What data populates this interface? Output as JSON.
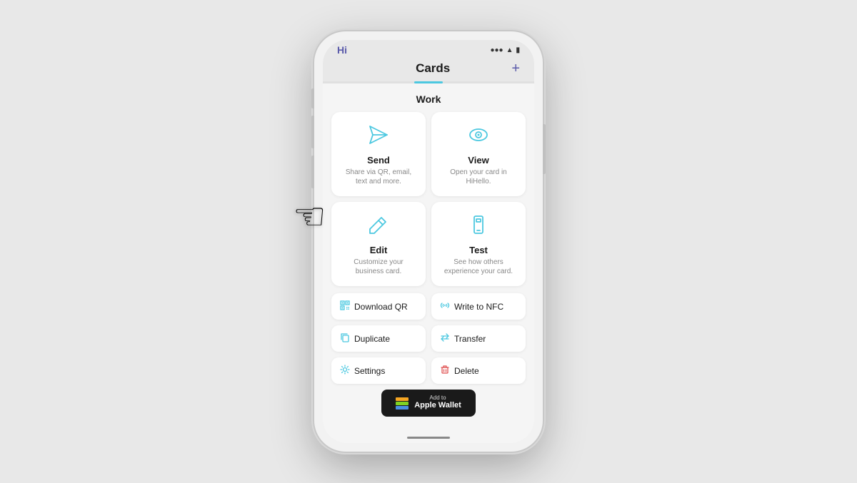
{
  "app": {
    "status_hi": "Hi",
    "title": "Cards",
    "add_button": "+"
  },
  "section": {
    "work_label": "Work"
  },
  "cards": [
    {
      "id": "send",
      "label": "Send",
      "description": "Share via QR, email, text and more.",
      "icon": "send"
    },
    {
      "id": "view",
      "label": "View",
      "description": "Open your card in HiHello.",
      "icon": "view"
    },
    {
      "id": "edit",
      "label": "Edit",
      "description": "Customize your business card.",
      "icon": "edit"
    },
    {
      "id": "test",
      "label": "Test",
      "description": "See how others experience your card.",
      "icon": "test"
    }
  ],
  "actions": [
    {
      "id": "download-qr",
      "label": "Download QR",
      "icon": "qr"
    },
    {
      "id": "write-to-nfc",
      "label": "Write to NFC",
      "icon": "nfc"
    },
    {
      "id": "duplicate",
      "label": "Duplicate",
      "icon": "duplicate"
    },
    {
      "id": "transfer",
      "label": "Transfer",
      "icon": "transfer"
    },
    {
      "id": "settings",
      "label": "Settings",
      "icon": "settings"
    },
    {
      "id": "delete",
      "label": "Delete",
      "icon": "delete"
    }
  ],
  "wallet": {
    "add_text": "Add to",
    "main_text": "Apple Wallet"
  },
  "colors": {
    "accent": "#4cc8e0",
    "purple": "#5a5aaa",
    "delete_red": "#e05555"
  }
}
